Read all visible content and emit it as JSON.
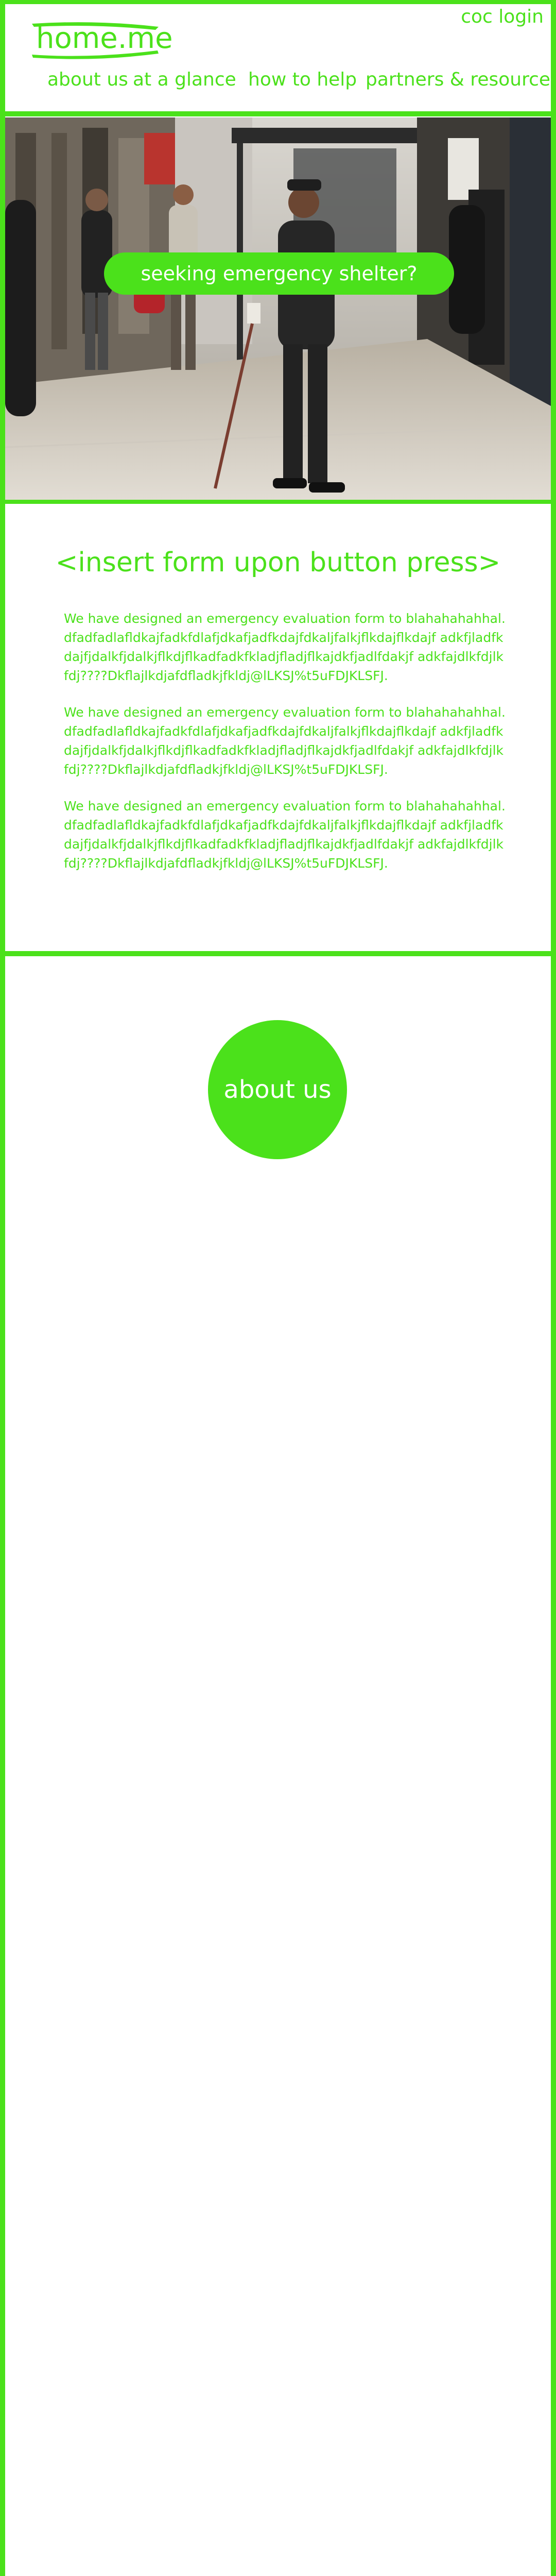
{
  "header": {
    "logo_text": "home.me",
    "login_label": "coc login",
    "nav": [
      "about us",
      "at a glance",
      "how to help",
      "partners & resources"
    ]
  },
  "hero": {
    "cta_label": "seeking emergency shelter?",
    "photo_description_icon": "street-photo"
  },
  "form_section": {
    "title": "<insert form upon button press>",
    "paragraphs": [
      "We have designed an emergency evaluation form to blahahahahhal. dfadfadlafldkajfadkfdlafjdkafjadfkdajfdkaljfalkjflkdajflkdajf adkfjladfkdajfjdalkfjdalkjflkdjflkadfadkfkladjfladjflkajdkfjadlfdakjf adkfajdlkfdjlkfdj????Dkflajlkdjafdfladkjfkldj@lLKSJ%t5uFDJKLSFJ.",
      "We have designed an emergency evaluation form to blahahahahhal. dfadfadlafldkajfadkfdlafjdkafjadfkdajfdkaljfalkjflkdajflkdajf adkfjladfkdajfjdalkfjdalkjflkdjflkadfadkfkladjfladjflkajdkfjadlfdakjf adkfajdlkfdjlkfdj????Dkflajlkdjafdfladkjfkldj@lLKSJ%t5uFDJKLSFJ.",
      "We have designed an emergency evaluation form to blahahahahhal. dfadfadlafldkajfadkfdlafjdkafjadfkdajfdkaljfalkjflkdajflkdajf adkfjladfkdajfjdalkfjdalkjflkdjflkadfadkfkladjfladjflkajdkfjadlfdakjf adkfajdlkfdjlkfdj????Dkflajlkdjafdfladkjfkldj@lLKSJ%t5uFDJKLSFJ."
    ]
  },
  "about": {
    "label": "about us"
  },
  "colors": {
    "accent": "#4be11b",
    "background": "#ffffff"
  }
}
